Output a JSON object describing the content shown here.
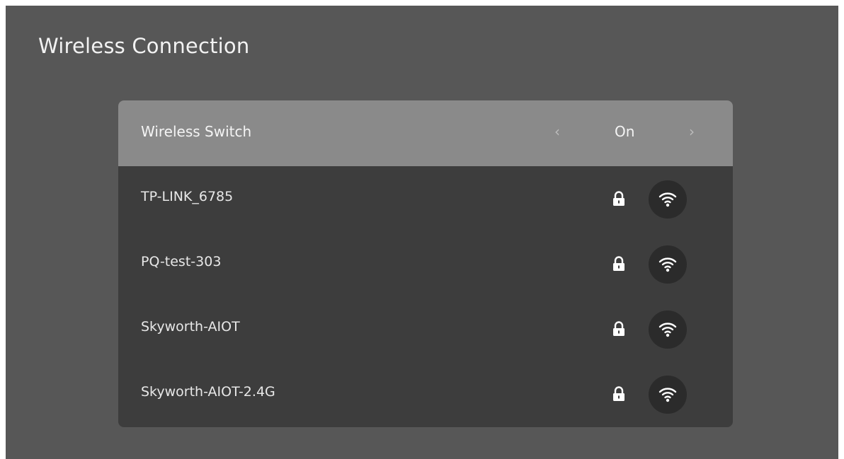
{
  "window": {
    "title": "Wireless Connection"
  },
  "wireless_switch": {
    "label": "Wireless Switch",
    "value": "On",
    "left_arrow": "‹",
    "right_arrow": "›"
  },
  "networks": [
    {
      "ssid": "TP-LINK_6785",
      "secured": true,
      "icon": "wifi-icon"
    },
    {
      "ssid": "PQ-test-303",
      "secured": true,
      "icon": "wifi-icon"
    },
    {
      "ssid": "Skyworth-AIOT",
      "secured": true,
      "icon": "wifi-icon"
    },
    {
      "ssid": "Skyworth-AIOT-2.4G",
      "secured": true,
      "icon": "wifi-icon"
    }
  ],
  "colors": {
    "background": "#575757",
    "panel": "#3d3d3d",
    "focused_row": "#8a8a8a"
  }
}
